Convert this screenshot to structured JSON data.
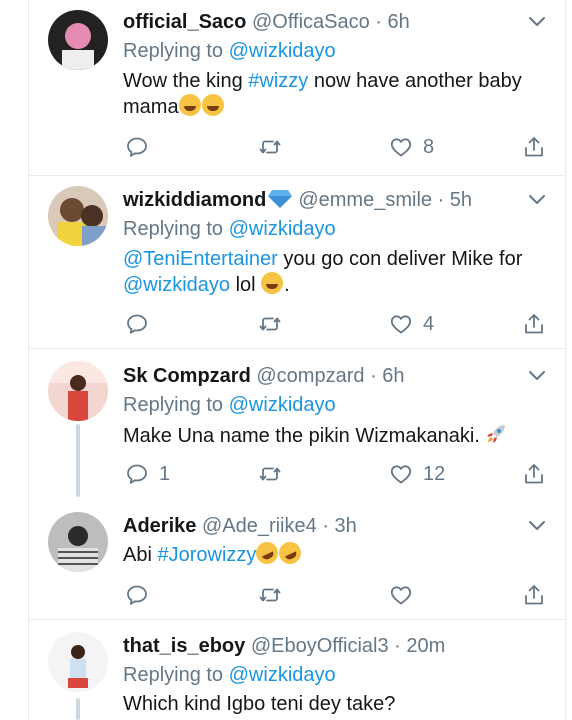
{
  "tweets": [
    {
      "name": "official_Saco",
      "handle": "@OfficaSaco",
      "time": "6h",
      "replying_prefix": "Replying to",
      "replying_to": "@wizkidayo",
      "text_a": "Wow the king",
      "hashtag": "#wizzy",
      "text_b": "now have another baby",
      "text_c": "mama",
      "likes": "8"
    },
    {
      "name": "wizkiddiamond",
      "handle": "@emme_smile",
      "time": "5h",
      "replying_prefix": "Replying to",
      "replying_to": "@wizkidayo",
      "mention1": "@TeniEntertainer",
      "text_a": "you go con deliver Mike for",
      "mention2": "@wizkidayo",
      "text_b": "lol",
      "text_c": ".",
      "likes": "4"
    },
    {
      "name": "Sk Compzard",
      "handle": "@compzard",
      "time": "6h",
      "replying_prefix": "Replying to",
      "replying_to": "@wizkidayo",
      "text_a": "Make Una name the pikin Wizmakanaki.",
      "replies": "1",
      "likes": "12"
    },
    {
      "name": "Aderike",
      "handle": "@Ade_riike4",
      "time": "3h",
      "text_a": "Abi",
      "hashtag": "#Jorowizzy"
    },
    {
      "name": "that_is_eboy",
      "handle": "@EboyOfficial3",
      "time": "20m",
      "replying_prefix": "Replying to",
      "replying_to": "@wizkidayo",
      "text_a": "Which kind Igbo teni dey take?"
    }
  ],
  "icons": [
    "reply-icon",
    "retweet-icon",
    "like-icon",
    "share-icon",
    "chevron-down-icon",
    "diamond-emoji",
    "laughing-emoji",
    "rolling-laughing-emoji",
    "rocket-emoji"
  ],
  "colors": {
    "link": "#1b95e0",
    "muted": "#657786",
    "text": "#14171a",
    "border": "#e6ecf0",
    "thread": "#ccd6dd"
  }
}
